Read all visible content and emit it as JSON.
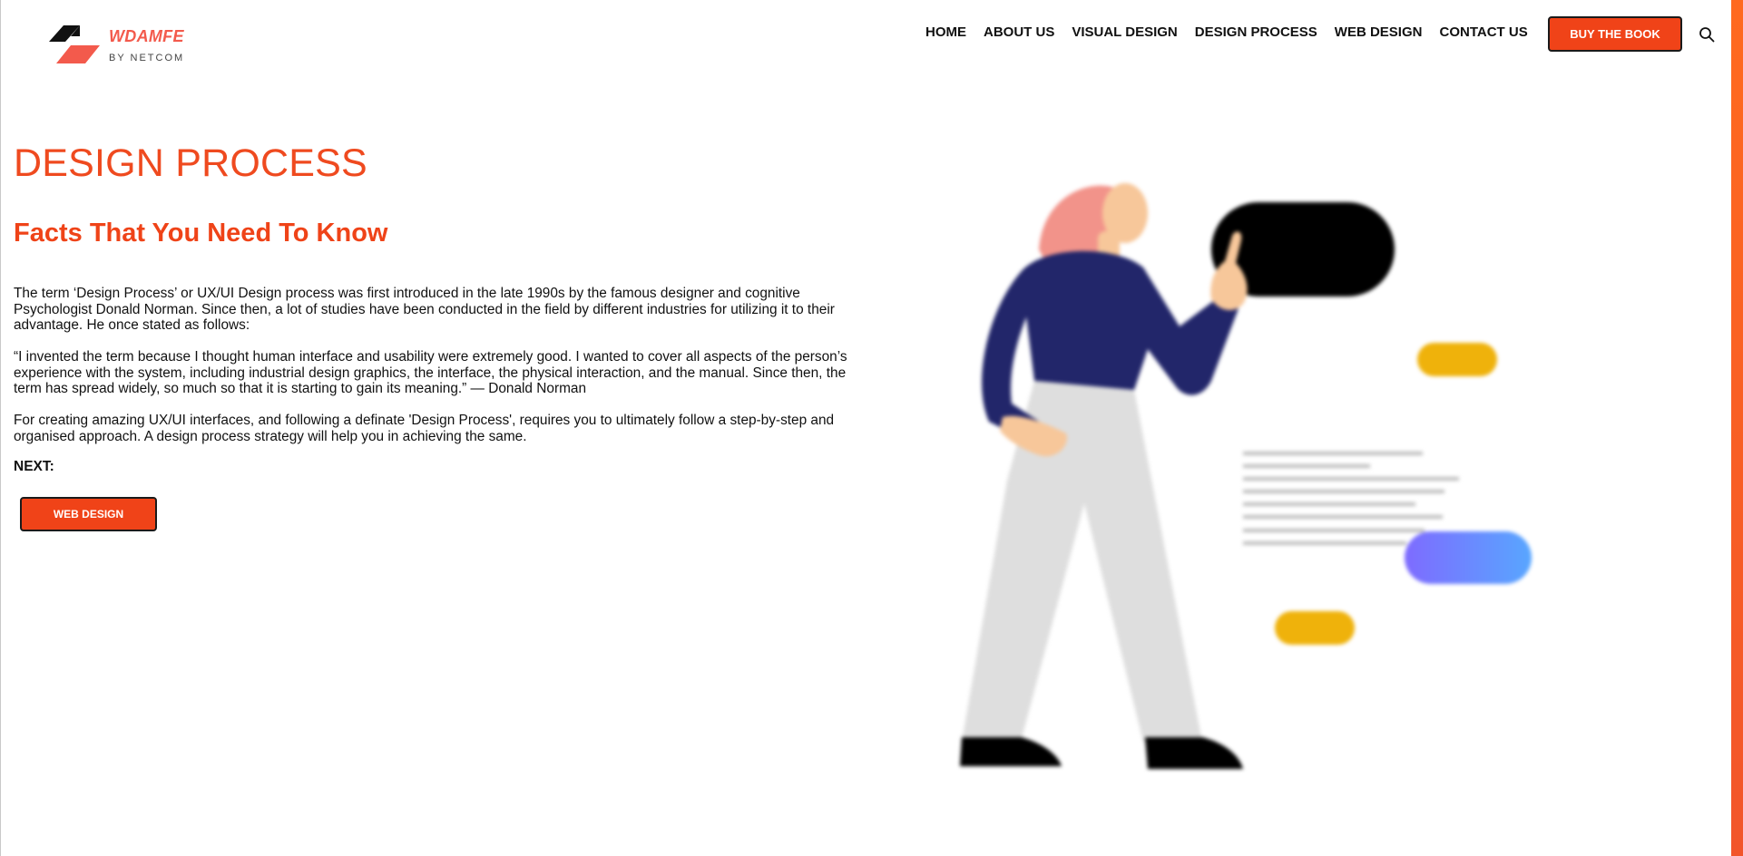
{
  "header": {
    "brand": "WDAMFE",
    "brand_sub": "BY NETCOM",
    "nav": [
      "HOME",
      "ABOUT US",
      "VISUAL DESIGN",
      "DESIGN PROCESS",
      "WEB DESIGN",
      "CONTACT US"
    ],
    "cta": "BUY THE BOOK"
  },
  "main": {
    "title": "DESIGN PROCESS",
    "subtitle": "Facts That You Need To Know",
    "paragraphs": [
      "The term ‘Design Process’ or UX/UI Design process was first introduced in the late 1990s by the famous designer and cognitive Psychologist Donald Norman. Since then, a lot of studies have been conducted in the field by different industries for utilizing it to their advantage. He once stated as follows:",
      "“I invented the term because I thought human interface and usability were extremely good. I wanted to cover all aspects of the person’s experience with the system, including industrial design graphics, the interface, the physical interaction, and the manual. Since then, the term has spread widely, so much so that it is starting to gain its meaning.” — Donald Norman",
      "For creating amazing UX/UI interfaces, and following a definate 'Design Process', requires you to ultimately follow a step-by-step and organised approach. A design process strategy will help you in achieving the same."
    ],
    "next_label": "NEXT:",
    "next_button": "WEB DESIGN"
  },
  "colors": {
    "accent": "#f04318",
    "brand": "#f35a4c",
    "shirt": "#22266a",
    "pants": "#dedede",
    "hair": "#f2938a",
    "skin": "#f7c79a",
    "yellow": "#efb20b"
  },
  "icons": [
    "logo-mark-icon",
    "search-icon"
  ]
}
